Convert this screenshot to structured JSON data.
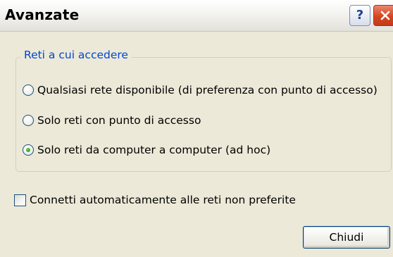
{
  "dialog": {
    "title": "Avanzate",
    "title_buttons": [
      {
        "name": "help",
        "glyph": "?"
      },
      {
        "name": "close",
        "icon": "close-x-icon"
      }
    ]
  },
  "group": {
    "legend": "Reti a cui accedere",
    "options": [
      {
        "label": "Qualsiasi rete disponibile (di preferenza con punto di accesso)",
        "selected": false
      },
      {
        "label": "Solo reti con punto di accesso",
        "selected": false
      },
      {
        "label": "Solo reti da computer a computer (ad hoc)",
        "selected": true
      }
    ]
  },
  "auto_connect": {
    "label": "Connetti automaticamente alle reti non preferite",
    "checked": false
  },
  "footer": {
    "close_label": "Chiudi"
  },
  "colors": {
    "window_bg": "#ece9d8",
    "legend_text": "#0046d5",
    "control_border": "#1c5180",
    "radio_selected": "#2fa628",
    "close_button_red": "#d6451f"
  }
}
